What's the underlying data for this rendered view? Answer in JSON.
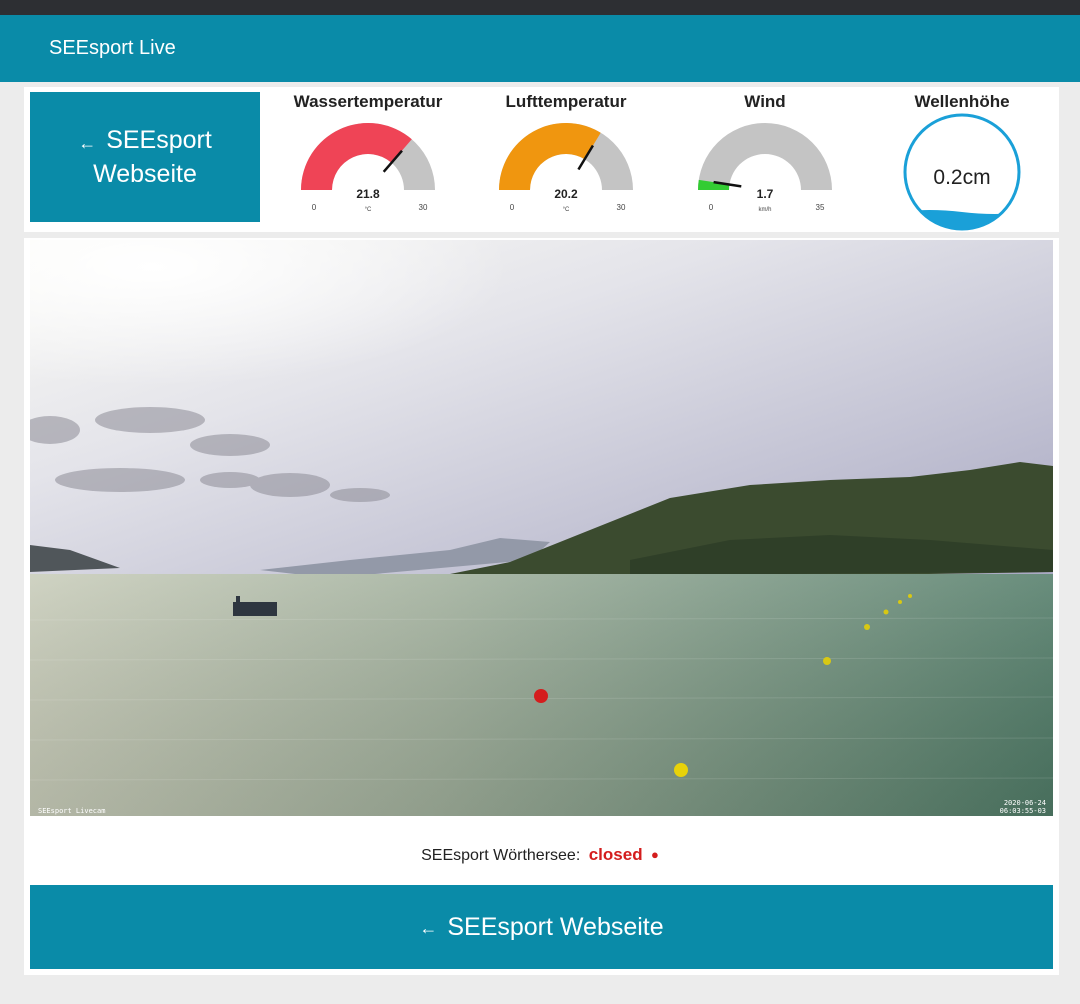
{
  "app": {
    "title": "SEEsport Live"
  },
  "top_button": {
    "label_line1": "SEEsport",
    "label_line2": "Webseite",
    "icon": "arrow-left-icon"
  },
  "gauges": [
    {
      "id": "water",
      "title": "Wassertemperatur",
      "value": "21.8",
      "value_num": 21.8,
      "unit": "°C",
      "min": "0",
      "max": "30",
      "min_num": 0,
      "max_num": 30,
      "color": "#ef4456"
    },
    {
      "id": "air",
      "title": "Lufttemperatur",
      "value": "20.2",
      "value_num": 20.2,
      "unit": "°C",
      "min": "0",
      "max": "30",
      "min_num": 0,
      "max_num": 30,
      "color": "#f0960f"
    },
    {
      "id": "wind",
      "title": "Wind",
      "value": "1.7",
      "value_num": 1.7,
      "unit": "km/h",
      "min": "0",
      "max": "35",
      "min_num": 0,
      "max_num": 35,
      "color": "#33cc33"
    }
  ],
  "wave": {
    "title": "Wellenhöhe",
    "value": "0.2cm",
    "color": "#1aa0d8"
  },
  "gauge_track_color": "#c4c4c4",
  "webcam": {
    "watermark_left": "SEEsport Livecam",
    "timestamp_date": "2020-06-24",
    "timestamp_time": "06:03:55-03"
  },
  "status": {
    "label": "SEEsport Wörthersee:",
    "value": "closed",
    "color": "#d41d1d"
  },
  "bottom_button": {
    "label": "SEEsport Webseite",
    "icon": "arrow-left-icon"
  },
  "brand_color": "#0a8ba8"
}
